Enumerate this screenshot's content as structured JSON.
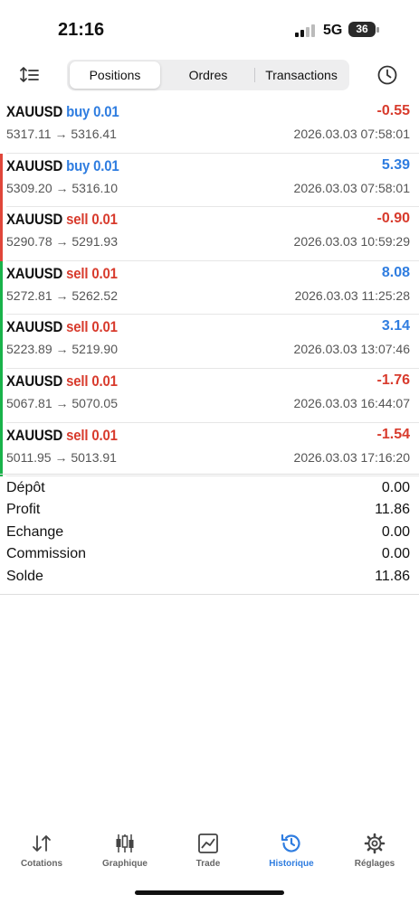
{
  "status_bar": {
    "time": "21:16",
    "network": "5G",
    "battery": "36"
  },
  "toolbar": {
    "tabs": [
      {
        "label": "Positions",
        "active": true
      },
      {
        "label": "Ordres",
        "active": false
      },
      {
        "label": "Transactions",
        "active": false
      }
    ],
    "sort_icon": "sort-icon",
    "history_icon": "clock-icon"
  },
  "colors": {
    "buy": "#2f7de0",
    "sell": "#d83b2d",
    "profit_positive": "#2f7de0",
    "profit_negative": "#d83b2d",
    "accent": "#2f7de0"
  },
  "positions": [
    {
      "symbol": "XAUUSD",
      "side": "buy",
      "volume": "0.01",
      "open": "5317.11",
      "close": "5316.41",
      "profit": "-0.55",
      "time": "2026.03.03 07:58:01",
      "marker": "none"
    },
    {
      "symbol": "XAUUSD",
      "side": "buy",
      "volume": "0.01",
      "open": "5309.20",
      "close": "5316.10",
      "profit": "5.39",
      "time": "2026.03.03 07:58:01",
      "marker": "red"
    },
    {
      "symbol": "XAUUSD",
      "side": "sell",
      "volume": "0.01",
      "open": "5290.78",
      "close": "5291.93",
      "profit": "-0.90",
      "time": "2026.03.03 10:59:29",
      "marker": "red"
    },
    {
      "symbol": "XAUUSD",
      "side": "sell",
      "volume": "0.01",
      "open": "5272.81",
      "close": "5262.52",
      "profit": "8.08",
      "time": "2026.03.03 11:25:28",
      "marker": "green"
    },
    {
      "symbol": "XAUUSD",
      "side": "sell",
      "volume": "0.01",
      "open": "5223.89",
      "close": "5219.90",
      "profit": "3.14",
      "time": "2026.03.03 13:07:46",
      "marker": "green"
    },
    {
      "symbol": "XAUUSD",
      "side": "sell",
      "volume": "0.01",
      "open": "5067.81",
      "close": "5070.05",
      "profit": "-1.76",
      "time": "2026.03.03 16:44:07",
      "marker": "green"
    },
    {
      "symbol": "XAUUSD",
      "side": "sell",
      "volume": "0.01",
      "open": "5011.95",
      "close": "5013.91",
      "profit": "-1.54",
      "time": "2026.03.03 17:16:20",
      "marker": "green"
    }
  ],
  "summary": [
    {
      "label": "Dépôt",
      "value": "0.00"
    },
    {
      "label": "Profit",
      "value": "11.86"
    },
    {
      "label": "Echange",
      "value": "0.00"
    },
    {
      "label": "Commission",
      "value": "0.00"
    },
    {
      "label": "Solde",
      "value": "11.86"
    }
  ],
  "tabbar": [
    {
      "label": "Cotations",
      "icon": "quotes-icon",
      "active": false
    },
    {
      "label": "Graphique",
      "icon": "chart-icon",
      "active": false
    },
    {
      "label": "Trade",
      "icon": "trade-icon",
      "active": false
    },
    {
      "label": "Historique",
      "icon": "history-icon",
      "active": true
    },
    {
      "label": "Réglages",
      "icon": "settings-icon",
      "active": false
    }
  ]
}
